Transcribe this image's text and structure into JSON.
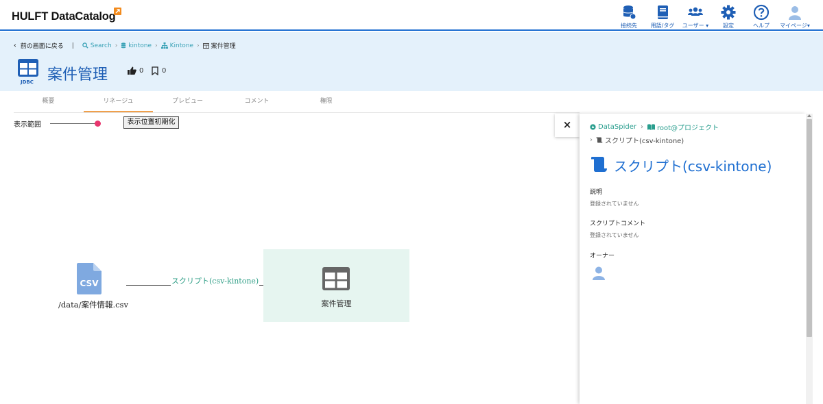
{
  "app": {
    "logo_text": "HULFT DataCatalog",
    "brand_color": "#1f5fb5",
    "accent_color": "#f28b1e"
  },
  "nav": [
    {
      "label": "接続先",
      "icon": "database-icon"
    },
    {
      "label": "用語/タグ",
      "icon": "book-icon"
    },
    {
      "label": "ユーザー ▾",
      "icon": "users-icon"
    },
    {
      "label": "設定",
      "icon": "gear-icon"
    },
    {
      "label": "ヘルプ",
      "icon": "help-icon"
    },
    {
      "label": "マイページ▾",
      "icon": "user-icon"
    }
  ],
  "breadcrumb": {
    "back": "前の画面に戻る",
    "items": [
      "Search",
      "kintone",
      "Kintone"
    ],
    "current": "案件管理"
  },
  "page": {
    "type_label": "JDBC",
    "title": "案件管理",
    "likes": "0",
    "bookmarks": "0"
  },
  "tabs": [
    {
      "label": "概要",
      "active": false
    },
    {
      "label": "リネージュ",
      "active": true
    },
    {
      "label": "プレビュー",
      "active": false
    },
    {
      "label": "コメント",
      "active": false
    },
    {
      "label": "権限",
      "active": false
    }
  ],
  "controls": {
    "range_label": "表示範囲",
    "reset_button": "表示位置初期化",
    "range_value": 1.0
  },
  "lineage": {
    "source_label": "/data/案件情報.csv",
    "edge_label": "スクリプト(csv-kintone)",
    "target_label": "案件管理"
  },
  "panel": {
    "close": "×",
    "crumb_root": "DataSpider",
    "crumb_project": "root@プロジェクト",
    "crumb_script": "スクリプト(csv-kintone)",
    "title": "スクリプト(csv-kintone)",
    "description_label": "説明",
    "description_value": "登録されていません",
    "comment_label": "スクリプトコメント",
    "comment_value": "登録されていません",
    "owner_label": "オーナー"
  }
}
